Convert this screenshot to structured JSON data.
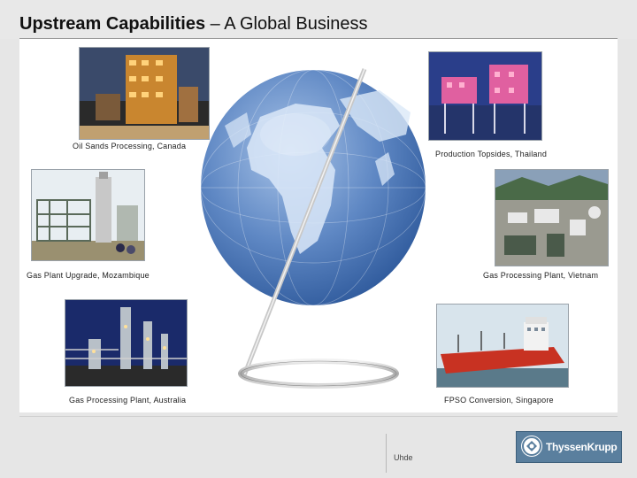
{
  "slide": {
    "title_bold": "Upstream Capabilities",
    "title_rest": " – A Global Business"
  },
  "projects": [
    {
      "caption": "Oil Sands Processing, Canada"
    },
    {
      "caption": "Production Topsides, Thailand"
    },
    {
      "caption": "Gas Plant Upgrade, Mozambique"
    },
    {
      "caption": "Gas Processing Plant, Vietnam"
    },
    {
      "caption": "Gas Processing Plant, Australia"
    },
    {
      "caption": "FPSO Conversion, Singapore"
    }
  ],
  "footer": {
    "division": "Uhde",
    "brand": "ThyssenKrupp",
    "brand_color": "#5a7f9e"
  },
  "colors": {
    "globe_ocean": "#3f6fb0",
    "globe_land": "#d7e6f7"
  }
}
